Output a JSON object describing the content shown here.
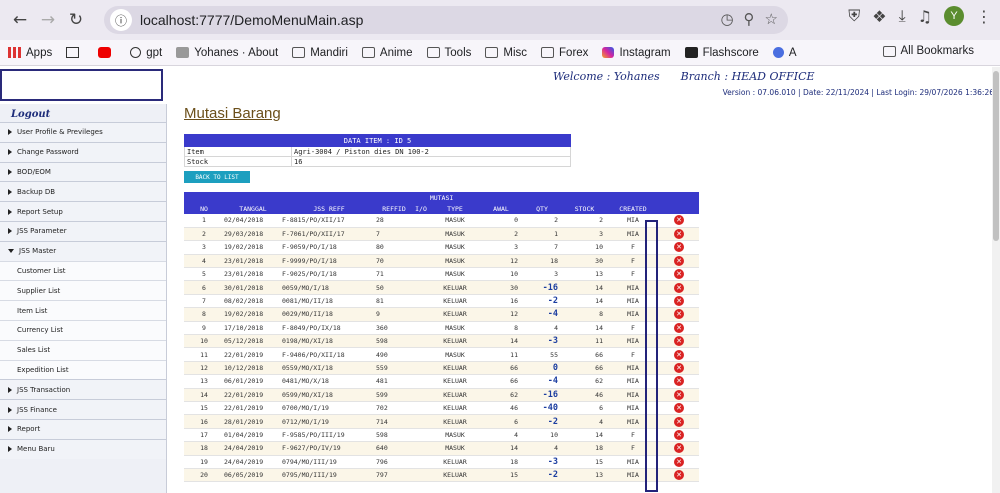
{
  "browser": {
    "url": "localhost:7777/DemoMenuMain.asp",
    "avatar_letter": "Y",
    "bookmarks": [
      "Apps",
      "gpt",
      "Yohanes · About",
      "Mandiri",
      "Anime",
      "Tools",
      "Misc",
      "Forex",
      "Instagram",
      "Flashscore",
      "A"
    ],
    "all_bookmarks": "All Bookmarks"
  },
  "header": {
    "welcome": "Welcome : Yohanes      Branch : HEAD OFFICE",
    "version": "Version : 07.06.010 | Date: 22/11/2024 | Last Login: 29/07/2026 1:36:26"
  },
  "sidebar": {
    "logout": "Logout",
    "items": [
      "User Profile & Previleges",
      "Change Password",
      "BOD/EOM",
      "Backup DB",
      "Report Setup",
      "JSS Parameter",
      "JSS Master"
    ],
    "sub_items": [
      "Customer List",
      "Supplier List",
      "Item List",
      "Currency List",
      "Sales List",
      "Expedition List"
    ],
    "items_after": [
      "JSS Transaction",
      "JSS Finance",
      "Report",
      "Menu Baru"
    ]
  },
  "main": {
    "title": "Mutasi Barang",
    "item_header": "DATA ITEM : ID 5",
    "item_rows": [
      {
        "label": "Item",
        "value": "Agri-3004 / Piston dies DN 100-2"
      },
      {
        "label": "Stock",
        "value": "16"
      }
    ],
    "back_button": "BACK TO LIST",
    "mutasi_header": "MUTASI",
    "columns": [
      "NO",
      "TANGGAL",
      "JSS REFF",
      "REFFID",
      "I/O",
      "TYPE",
      "AWAL",
      "QTY",
      "STOCK",
      "CREATED",
      ""
    ],
    "rows": [
      [
        "1",
        "02/04/2018",
        "F-8815/PO/XII/17",
        "28",
        "",
        "MASUK",
        "0",
        "2",
        "2",
        "MIA"
      ],
      [
        "2",
        "29/03/2018",
        "F-7061/PO/XII/17",
        "7",
        "",
        "MASUK",
        "2",
        "1",
        "3",
        "MIA"
      ],
      [
        "3",
        "19/02/2018",
        "F-9059/PO/I/18",
        "80",
        "",
        "MASUK",
        "3",
        "7",
        "10",
        "F"
      ],
      [
        "4",
        "23/01/2018",
        "F-9999/PO/I/18",
        "70",
        "",
        "MASUK",
        "12",
        "18",
        "30",
        "F"
      ],
      [
        "5",
        "23/01/2018",
        "F-9025/PO/I/18",
        "71",
        "",
        "MASUK",
        "10",
        "3",
        "13",
        "F"
      ],
      [
        "6",
        "30/01/2018",
        "0059/MO/I/18",
        "50",
        "",
        "KELUAR",
        "30",
        "-16",
        "14",
        "MIA"
      ],
      [
        "7",
        "08/02/2018",
        "0081/MO/II/18",
        "81",
        "",
        "KELUAR",
        "16",
        "-2",
        "14",
        "MIA"
      ],
      [
        "8",
        "19/02/2018",
        "0029/MO/II/18",
        "9",
        "",
        "KELUAR",
        "12",
        "-4",
        "8",
        "MIA"
      ],
      [
        "9",
        "17/10/2018",
        "F-8049/PO/IX/18",
        "360",
        "",
        "MASUK",
        "8",
        "4",
        "14",
        "F"
      ],
      [
        "10",
        "05/12/2018",
        "0198/MO/XI/18",
        "598",
        "",
        "KELUAR",
        "14",
        "-3",
        "11",
        "MIA"
      ],
      [
        "11",
        "22/01/2019",
        "F-9406/PO/XII/18",
        "490",
        "",
        "MASUK",
        "11",
        "55",
        "66",
        "F"
      ],
      [
        "12",
        "10/12/2018",
        "0559/MO/XI/18",
        "559",
        "",
        "KELUAR",
        "66",
        "0",
        "66",
        "MIA"
      ],
      [
        "13",
        "06/01/2019",
        "0481/MO/X/18",
        "481",
        "",
        "KELUAR",
        "66",
        "-4",
        "62",
        "MIA"
      ],
      [
        "14",
        "22/01/2019",
        "0599/MO/XI/18",
        "599",
        "",
        "KELUAR",
        "62",
        "-16",
        "46",
        "MIA"
      ],
      [
        "15",
        "22/01/2019",
        "0700/MO/I/19",
        "702",
        "",
        "KELUAR",
        "46",
        "-40",
        "6",
        "MIA"
      ],
      [
        "16",
        "28/01/2019",
        "0712/MO/I/19",
        "714",
        "",
        "KELUAR",
        "6",
        "-2",
        "4",
        "MIA"
      ],
      [
        "17",
        "01/04/2019",
        "F-9585/PO/III/19",
        "598",
        "",
        "MASUK",
        "4",
        "10",
        "14",
        "F"
      ],
      [
        "18",
        "24/04/2019",
        "F-9627/PO/IV/19",
        "640",
        "",
        "MASUK",
        "14",
        "4",
        "18",
        "F"
      ],
      [
        "19",
        "24/04/2019",
        "0794/MO/III/19",
        "796",
        "",
        "KELUAR",
        "18",
        "-3",
        "15",
        "MIA"
      ],
      [
        "20",
        "06/05/2019",
        "0795/MO/III/19",
        "797",
        "",
        "KELUAR",
        "15",
        "-2",
        "13",
        "MIA"
      ]
    ]
  }
}
